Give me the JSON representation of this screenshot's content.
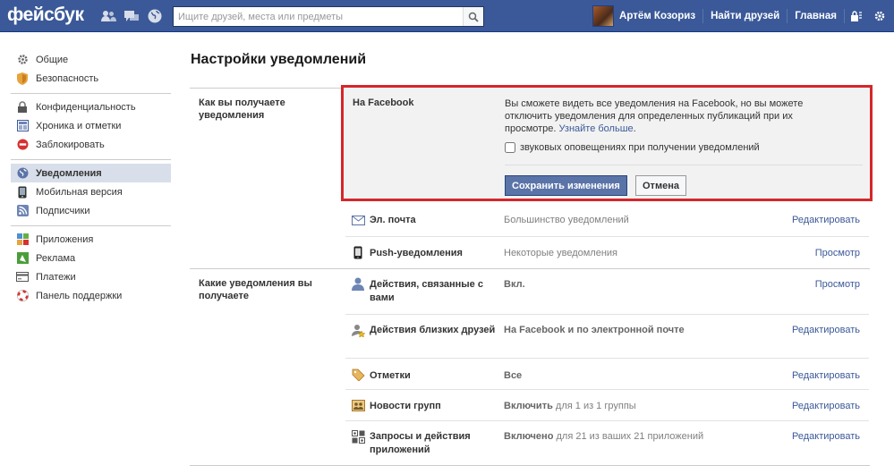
{
  "topbar": {
    "logo": "фейсбук",
    "search_placeholder": "Ищите друзей, места или предметы",
    "user_name": "Артём Козориз",
    "find_friends": "Найти друзей",
    "home": "Главная"
  },
  "sidebar": {
    "groups": [
      [
        {
          "label": "Общие",
          "icon": "gear-icon"
        },
        {
          "label": "Безопасность",
          "icon": "shield-icon"
        }
      ],
      [
        {
          "label": "Конфиденциальность",
          "icon": "lock-icon"
        },
        {
          "label": "Хроника и отметки",
          "icon": "timeline-icon"
        },
        {
          "label": "Заблокировать",
          "icon": "block-icon"
        }
      ],
      [
        {
          "label": "Уведомления",
          "icon": "globe-icon",
          "active": true
        },
        {
          "label": "Мобильная версия",
          "icon": "mobile-icon"
        },
        {
          "label": "Подписчики",
          "icon": "rss-icon"
        }
      ],
      [
        {
          "label": "Приложения",
          "icon": "apps-icon"
        },
        {
          "label": "Реклама",
          "icon": "ads-icon"
        },
        {
          "label": "Платежи",
          "icon": "payments-icon"
        },
        {
          "label": "Панель поддержки",
          "icon": "lifebuoy-icon"
        }
      ]
    ]
  },
  "main": {
    "title": "Настройки уведомлений",
    "section1": {
      "label": "Как вы получаете уведомления",
      "facebook_box": {
        "title": "На Facebook",
        "desc": "Вы сможете видеть все уведомления на Facebook, но вы можете отключить уведомления для определенных публикаций при их просмотре.",
        "learn_more": "Узнайте больше",
        "checkbox_label": "звуковых оповещениях при получении уведомлений",
        "checkbox_checked": false,
        "save": "Сохранить изменения",
        "cancel": "Отмена"
      },
      "rows": [
        {
          "name": "Эл. почта",
          "value": "Большинство уведомлений",
          "action": "Редактировать",
          "icon": "envelope-icon"
        },
        {
          "name": "Push-уведомления",
          "value": "Некоторые уведомления",
          "action": "Просмотр",
          "icon": "phone-icon"
        }
      ]
    },
    "section2": {
      "label": "Какие уведомления вы получаете",
      "rows": [
        {
          "name": "Действия, связанные с вами",
          "value_bold": "Вкл.",
          "value_rest": "",
          "action": "Просмотр",
          "icon": "person-icon"
        },
        {
          "name": "Действия близких друзей",
          "value_bold": "На Facebook и по электронной почте",
          "value_rest": "",
          "action": "Редактировать",
          "icon": "star-person-icon"
        },
        {
          "name": "Отметки",
          "value_bold": "Все",
          "value_rest": "",
          "action": "Редактировать",
          "icon": "tag-icon"
        },
        {
          "name": "Новости групп",
          "value_bold": "Включить",
          "value_rest": " для 1 из 1 группы",
          "action": "Редактировать",
          "icon": "group-icon"
        },
        {
          "name": "Запросы и действия приложений",
          "value_bold": "Включено",
          "value_rest": " для 21 из ваших 21 приложений",
          "action": "Редактировать",
          "icon": "apps-grid-icon"
        }
      ]
    }
  }
}
